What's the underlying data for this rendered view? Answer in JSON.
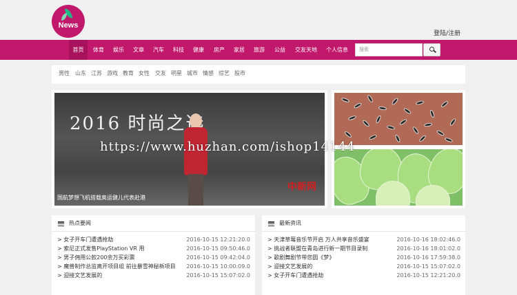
{
  "logo": {
    "text": "News",
    "icon": "leaf-icon"
  },
  "header": {
    "login": "登陆/注册"
  },
  "nav": {
    "items": [
      "首页",
      "体育",
      "娱乐",
      "文章",
      "汽车",
      "科技",
      "健康",
      "房产",
      "家居",
      "旅游",
      "公益",
      "交友天地",
      "个人信息"
    ],
    "active": 0
  },
  "search": {
    "placeholder": "搜索",
    "icon": "search-icon"
  },
  "tags": [
    "男性",
    "山东",
    "江苏",
    "游戏",
    "教育",
    "女性",
    "交友",
    "明星",
    "城市",
    "情感",
    "综艺",
    "股市"
  ],
  "banner": {
    "title": "2016 时尚之选",
    "logo": "中新网",
    "caption": "国航梦想飞机搭载奥运健儿代表赴港"
  },
  "watermark": "https://www.huzhan.com/ishop14144",
  "panels": [
    {
      "title": "热点要闻",
      "items": [
        {
          "title": "女子开车门遭遇抢劫",
          "date": "2016-10-15 12:21:20.0"
        },
        {
          "title": "索尼正式发售PlayStation VR 用",
          "date": "2016-10-15 09:50:46.0"
        },
        {
          "title": "男子佣用公款200余万买彩票",
          "date": "2016-10-15 09:42:04.0"
        },
        {
          "title": "魔兽制作总监离开项目组 前往暴雪神秘新项目",
          "date": "2016-10-15 10:00:09.0"
        },
        {
          "title": "迎接文艺发展的",
          "date": "2016-10-15 15:07:02.0"
        }
      ]
    },
    {
      "title": "最新资讯",
      "items": [
        {
          "title": "天津草莓音乐节开启 万人共享音乐盛宴",
          "date": "2016-10-16 18:02:46.0"
        },
        {
          "title": "挑战者联盟在青岛进行新一期节目录制",
          "date": "2016-10-16 18:01:02.0"
        },
        {
          "title": "歌剧舞剧节带您圆《梦》",
          "date": "2016-10-16 17:59:38.0"
        },
        {
          "title": "迎接文艺发展的",
          "date": "2016-10-15 15:07:02.0"
        },
        {
          "title": "女子开车门遭遇抢劫",
          "date": "2016-10-15 12:21:20.0"
        }
      ]
    }
  ]
}
